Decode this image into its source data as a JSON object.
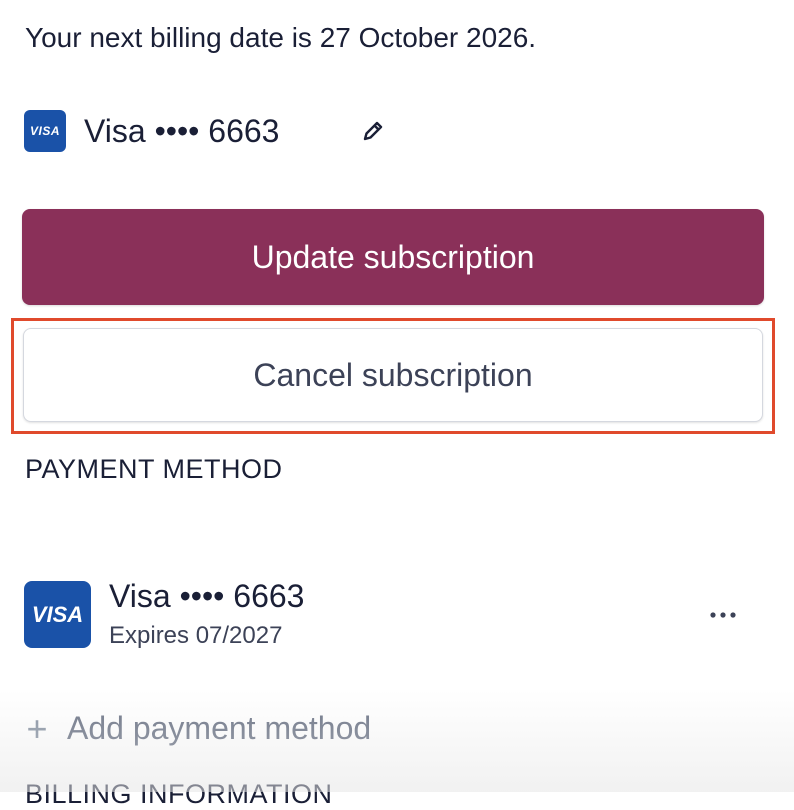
{
  "billing": {
    "next_billing_text": "Your next billing date is 27 October 2026."
  },
  "current_card": {
    "brand_badge": "VISA",
    "label": "Visa •••• 6663",
    "edit_icon": "pencil-icon"
  },
  "actions": {
    "update_label": "Update subscription",
    "cancel_label": "Cancel subscription",
    "primary_color": "#8a3059",
    "highlight_color": "#e04a2c"
  },
  "payment_method": {
    "section_title": "PAYMENT METHOD",
    "cards": [
      {
        "brand_badge": "VISA",
        "label": "Visa •••• 6663",
        "expiry": "Expires 07/2027",
        "menu_icon": "more-horizontal-icon"
      }
    ],
    "add_label": "Add payment method",
    "add_icon": "plus-icon"
  },
  "next_section": {
    "title": "BILLING INFORMATION"
  }
}
